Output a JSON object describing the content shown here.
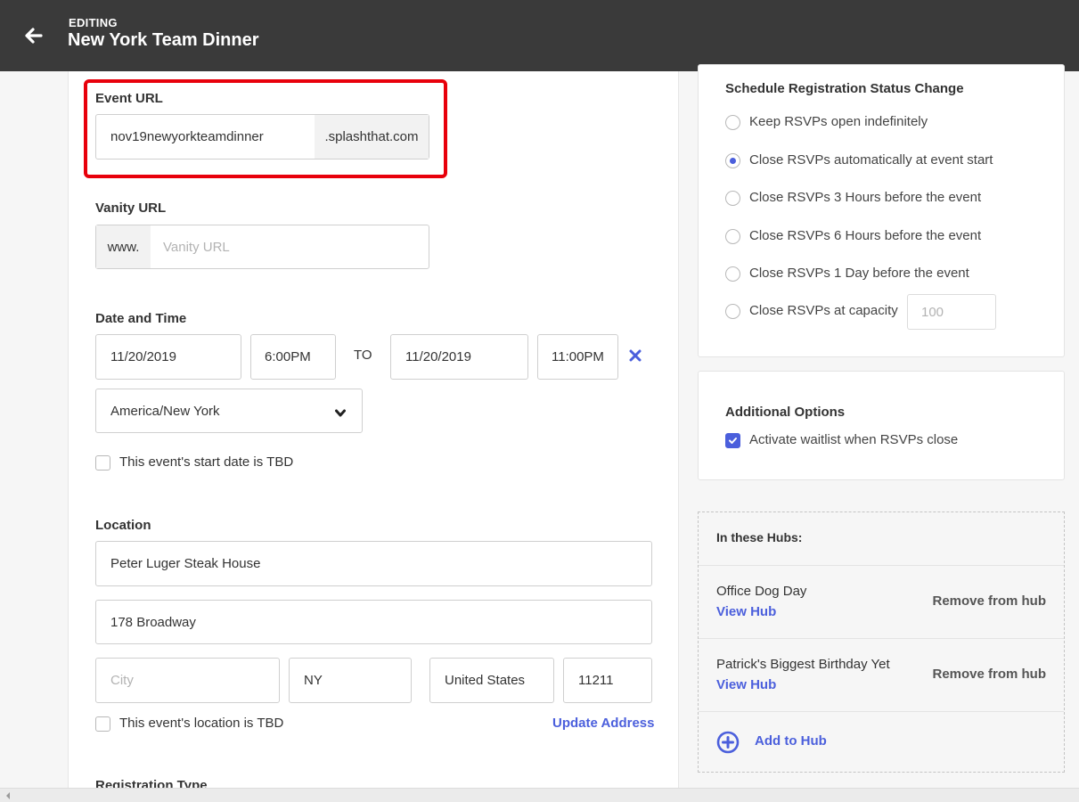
{
  "header": {
    "editing_label": "EDITING",
    "title": "New York Team Dinner"
  },
  "event_url": {
    "label": "Event URL",
    "value": "nov19newyorkteamdinner",
    "suffix": ".splashthat.com"
  },
  "vanity_url": {
    "label": "Vanity URL",
    "prefix": "www.",
    "placeholder": "Vanity URL"
  },
  "date_time": {
    "label": "Date and Time",
    "start_date": "11/20/2019",
    "start_time": "6:00PM",
    "to_label": "TO",
    "end_date": "11/20/2019",
    "end_time": "11:00PM",
    "timezone": "America/New York",
    "tbd_label": "This event's start date is TBD"
  },
  "location": {
    "label": "Location",
    "venue": "Peter Luger Steak House",
    "address": "178 Broadway",
    "city_placeholder": "City",
    "state": "NY",
    "country": "United States",
    "zip": "11211",
    "tbd_label": "This event's location is TBD",
    "update_link": "Update Address"
  },
  "registration_type_label": "Registration Type",
  "schedule": {
    "title": "Schedule Registration Status Change",
    "options": [
      {
        "label": "Keep RSVPs open indefinitely",
        "checked": false
      },
      {
        "label": "Close RSVPs automatically at event start",
        "checked": true
      },
      {
        "label": "Close RSVPs 3 Hours before the event",
        "checked": false
      },
      {
        "label": "Close RSVPs 6 Hours before the event",
        "checked": false
      },
      {
        "label": "Close RSVPs 1 Day before the event",
        "checked": false
      },
      {
        "label": "Close RSVPs at capacity",
        "checked": false
      }
    ],
    "capacity_placeholder": "100"
  },
  "additional": {
    "title": "Additional Options",
    "waitlist_label": "Activate waitlist when RSVPs close",
    "waitlist_checked": true
  },
  "hubs": {
    "title": "In these Hubs:",
    "items": [
      {
        "name": "Office Dog Day",
        "view": "View Hub",
        "remove": "Remove from hub"
      },
      {
        "name": "Patrick's Biggest Birthday Yet",
        "view": "View Hub",
        "remove": "Remove from hub"
      }
    ],
    "add_label": "Add to Hub"
  },
  "colors": {
    "accent": "#4b5fdc",
    "highlight": "#e8000b",
    "topbar": "#3a3a3a"
  }
}
